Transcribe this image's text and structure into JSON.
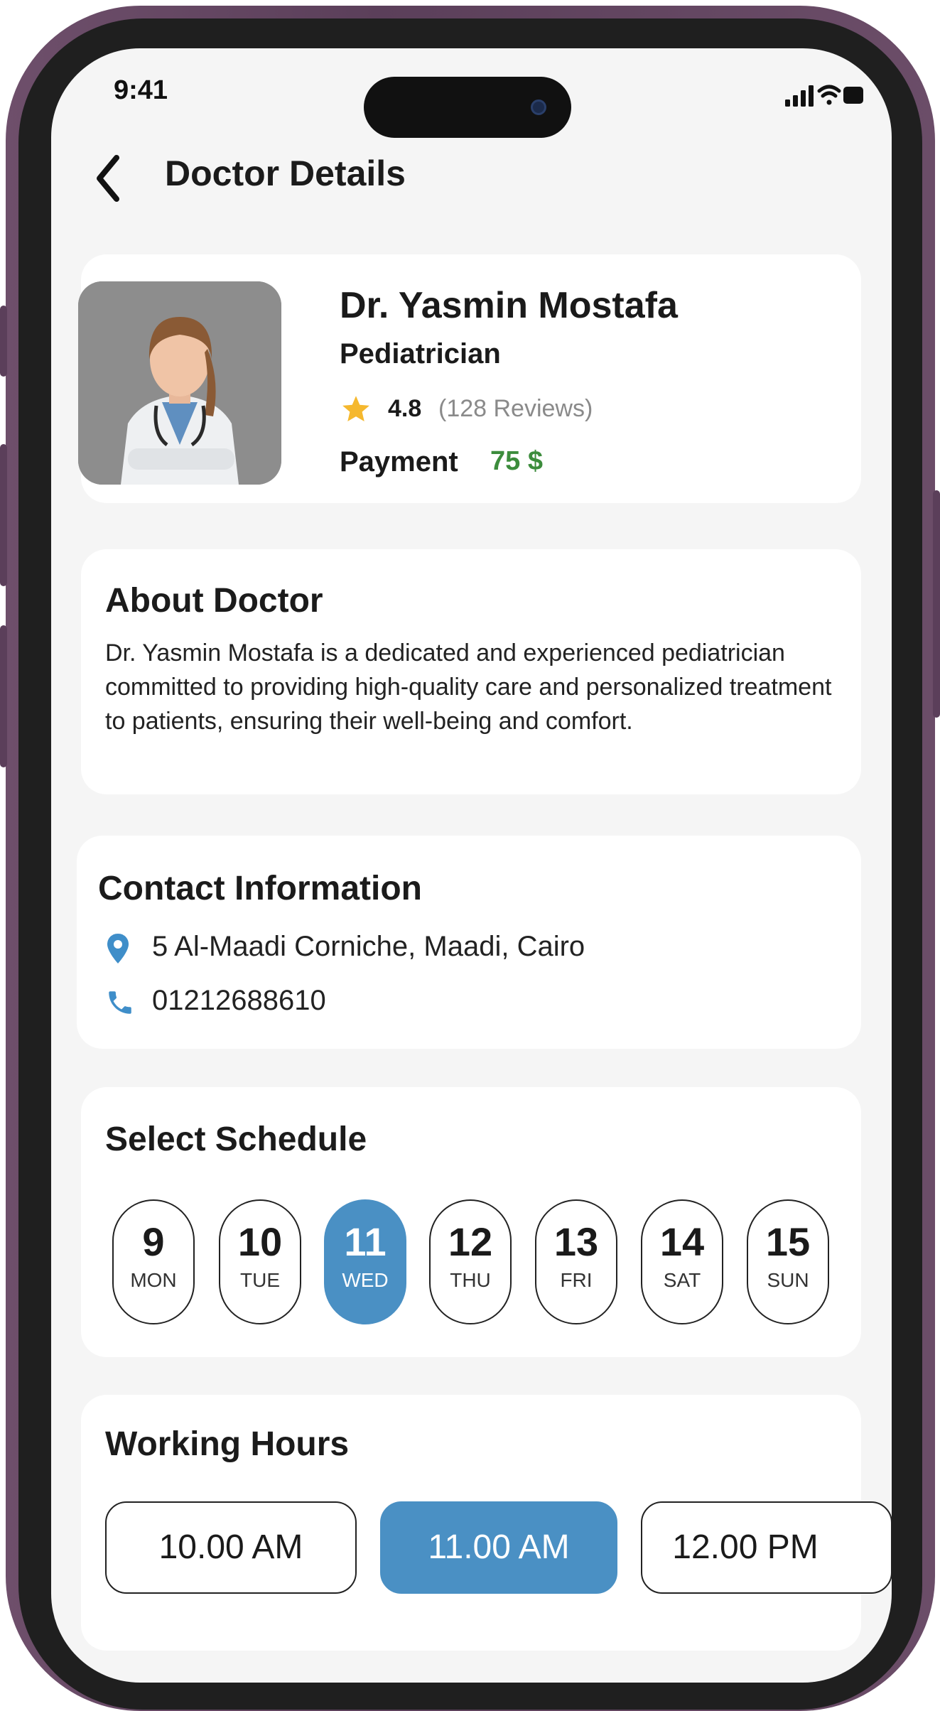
{
  "status_bar": {
    "time": "9:41"
  },
  "header": {
    "title": "Doctor Details",
    "back_icon": "chevron-left-icon"
  },
  "doctor": {
    "name": "Dr. Yasmin Mostafa",
    "specialty": "Pediatrician",
    "rating": "4.8",
    "reviews": "(128 Reviews)",
    "payment_label": "Payment",
    "payment_value": "75 $"
  },
  "about": {
    "title": "About Doctor",
    "text": "Dr. Yasmin Mostafa is a dedicated and experienced pediatrician committed to providing high-quality care and personalized treatment to patients, ensuring their well-being and comfort."
  },
  "contact": {
    "title": "Contact Information",
    "address": "5 Al-Maadi Corniche, Maadi, Cairo",
    "phone": "01212688610"
  },
  "schedule": {
    "title": "Select Schedule",
    "days": [
      {
        "num": "9",
        "name": "MON",
        "selected": false
      },
      {
        "num": "10",
        "name": "TUE",
        "selected": false
      },
      {
        "num": "11",
        "name": "WED",
        "selected": true
      },
      {
        "num": "12",
        "name": "THU",
        "selected": false
      },
      {
        "num": "13",
        "name": "FRI",
        "selected": false
      },
      {
        "num": "14",
        "name": "SAT",
        "selected": false
      },
      {
        "num": "15",
        "name": "SUN",
        "selected": false
      }
    ]
  },
  "working_hours": {
    "title": "Working Hours",
    "slots": [
      {
        "label": "10.00 AM",
        "selected": false
      },
      {
        "label": "11.00 AM",
        "selected": true
      },
      {
        "label": "12.00 PM",
        "selected": false
      }
    ]
  },
  "colors": {
    "accent": "#4a90c4",
    "payment": "#3c8c3c",
    "star": "#f5b82e",
    "frame": "#5b3f5a"
  }
}
